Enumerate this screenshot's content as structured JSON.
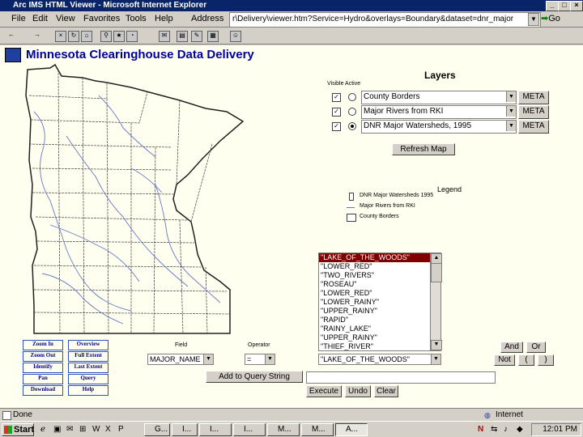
{
  "window": {
    "title": "Arc IMS HTML Viewer - Microsoft Internet Explorer"
  },
  "menu": [
    "File",
    "Edit",
    "View",
    "Favorites",
    "Tools",
    "Help"
  ],
  "address": {
    "label": "Address",
    "value": "r\\Delivery\\viewer.htm?Service=Hydro&overlays=Boundary&dataset=dnr_major",
    "go": "Go"
  },
  "app": {
    "title": "Minnesota Clearinghouse Data Delivery"
  },
  "layers": {
    "title": "Layers",
    "visible_label": "Visible Active",
    "rows": [
      {
        "name": "County Borders",
        "visible": true,
        "active": false,
        "meta": "META"
      },
      {
        "name": "Major Rivers from RKI",
        "visible": true,
        "active": false,
        "meta": "META"
      },
      {
        "name": "DNR Major Watersheds, 1995",
        "visible": true,
        "active": true,
        "meta": "META"
      }
    ],
    "refresh": "Refresh Map"
  },
  "legend": {
    "title": "Legend",
    "items": [
      "DNR Major Watersheds 1995",
      "Major Rivers from RKI",
      "County Borders"
    ]
  },
  "listbox": {
    "items": [
      "\"LAKE_OF_THE_WOODS\"",
      "\"LOWER_RED\"",
      "\"TWO_RIVERS\"",
      "\"ROSEAU\"",
      "\"LOWER_RED\"",
      "\"LOWER_RAINY\"",
      "\"UPPER_RAINY\"",
      "\"RAPID\"",
      "\"RAINY_LAKE\"",
      "\"UPPER_RAINY\"",
      "\"THIEF_RIVER\""
    ],
    "selected_index": 0
  },
  "nav": {
    "left": [
      "Zoom In",
      "Zoom Out",
      "Identify",
      "Pan",
      "Download"
    ],
    "right": [
      "Overview",
      "Full Extent",
      "Last Extent",
      "Query",
      "Help"
    ]
  },
  "query": {
    "field_label": "Field",
    "field_value": "MAJOR_NAME",
    "operator_label": "Operator",
    "operator_value": "=",
    "value_selected": "\"LAKE_OF_THE_WOODS\"",
    "and": "And",
    "or": "Or",
    "not": "Not",
    "open_paren": "(",
    "close_paren": ")",
    "add_button": "Add to Query String",
    "execute": "Execute",
    "undo": "Undo",
    "clear": "Clear"
  },
  "status": {
    "text": "Done",
    "zone": "Internet"
  },
  "taskbar": {
    "start": "Start",
    "tasks": [
      "G...",
      "I...",
      "I...",
      "I...",
      "M...",
      "M...",
      "A..."
    ],
    "clock": "12:01 PM"
  }
}
